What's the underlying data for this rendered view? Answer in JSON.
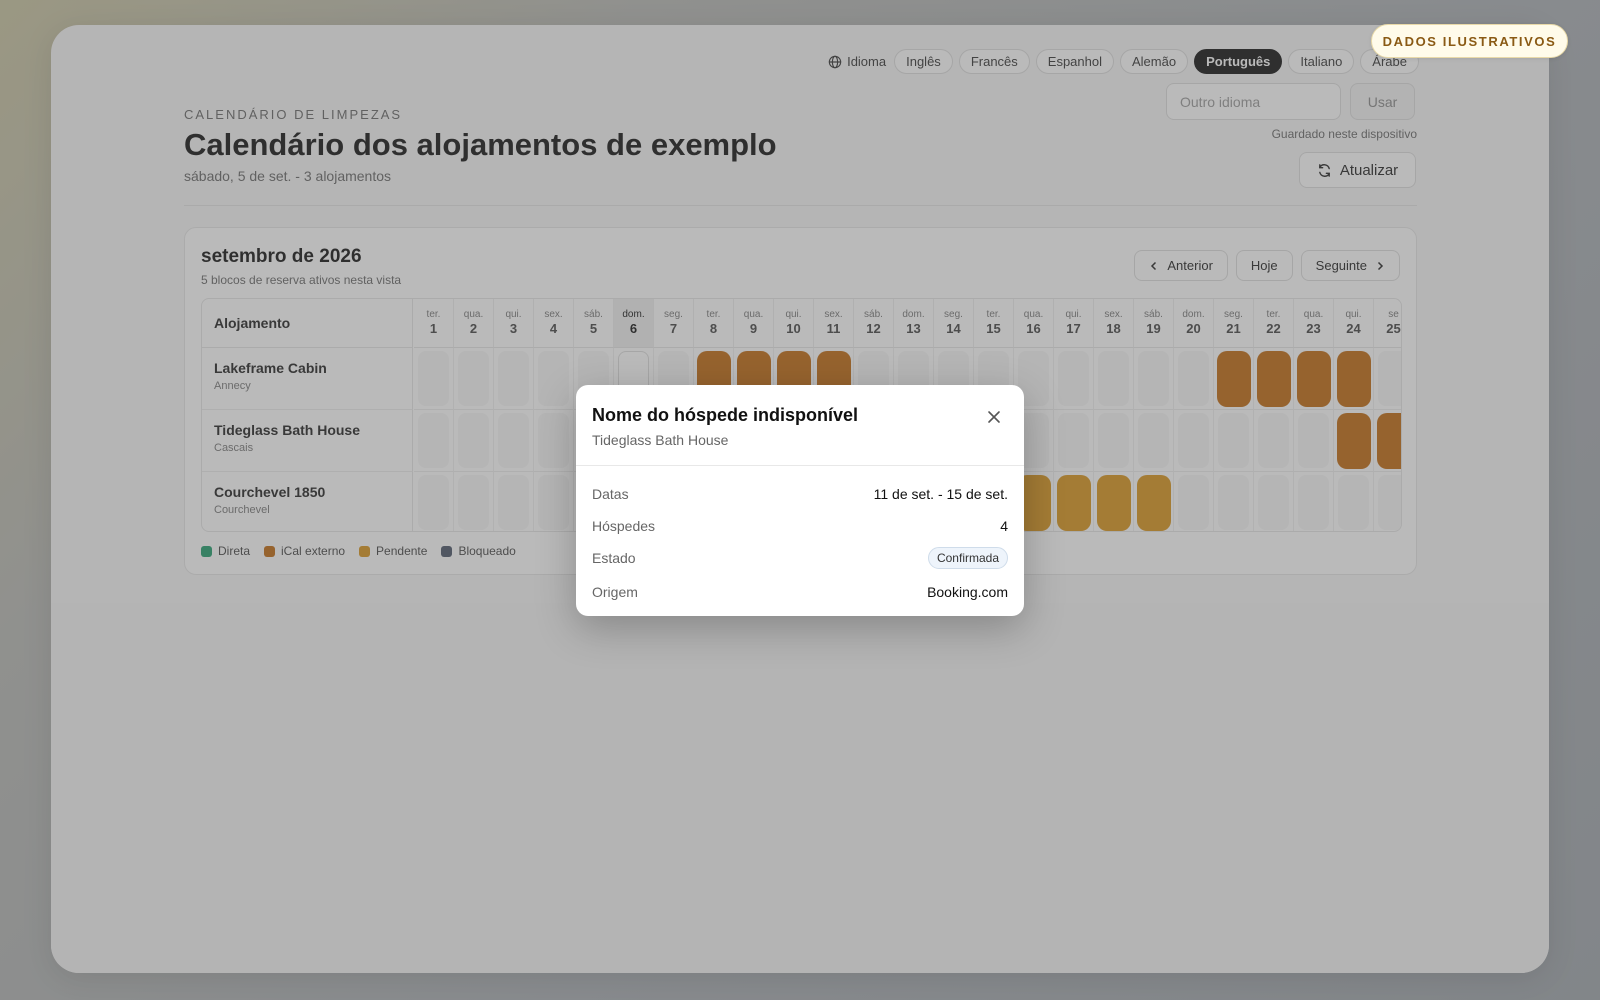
{
  "badge": "DADOS ILUSTRATIVOS",
  "language": {
    "label": "Idioma",
    "options": [
      {
        "label": "Inglês",
        "active": false
      },
      {
        "label": "Francês",
        "active": false
      },
      {
        "label": "Espanhol",
        "active": false
      },
      {
        "label": "Alemão",
        "active": false
      },
      {
        "label": "Português",
        "active": true
      },
      {
        "label": "Italiano",
        "active": false
      },
      {
        "label": "Árabe",
        "active": false
      }
    ],
    "other_placeholder": "Outro idioma",
    "use_label": "Usar",
    "saved_note": "Guardado neste dispositivo"
  },
  "header": {
    "eyebrow": "CALENDÁRIO DE LIMPEZAS",
    "title": "Calendário dos alojamentos de exemplo",
    "subtitle": "sábado, 5 de set. - 3 alojamentos",
    "refresh_label": "Atualizar"
  },
  "calendar": {
    "month": "setembro de 2026",
    "count_text": "5 blocos de reserva ativos nesta vista",
    "nav": {
      "prev": "Anterior",
      "today": "Hoje",
      "next": "Seguinte"
    },
    "property_header": "Alojamento",
    "today_index": 5,
    "days": [
      {
        "dw": "ter.",
        "dn": "1"
      },
      {
        "dw": "qua.",
        "dn": "2"
      },
      {
        "dw": "qui.",
        "dn": "3"
      },
      {
        "dw": "sex.",
        "dn": "4"
      },
      {
        "dw": "sáb.",
        "dn": "5"
      },
      {
        "dw": "dom.",
        "dn": "6"
      },
      {
        "dw": "seg.",
        "dn": "7"
      },
      {
        "dw": "ter.",
        "dn": "8"
      },
      {
        "dw": "qua.",
        "dn": "9"
      },
      {
        "dw": "qui.",
        "dn": "10"
      },
      {
        "dw": "sex.",
        "dn": "11"
      },
      {
        "dw": "sáb.",
        "dn": "12"
      },
      {
        "dw": "dom.",
        "dn": "13"
      },
      {
        "dw": "seg.",
        "dn": "14"
      },
      {
        "dw": "ter.",
        "dn": "15"
      },
      {
        "dw": "qua.",
        "dn": "16"
      },
      {
        "dw": "qui.",
        "dn": "17"
      },
      {
        "dw": "sex.",
        "dn": "18"
      },
      {
        "dw": "sáb.",
        "dn": "19"
      },
      {
        "dw": "dom.",
        "dn": "20"
      },
      {
        "dw": "seg.",
        "dn": "21"
      },
      {
        "dw": "ter.",
        "dn": "22"
      },
      {
        "dw": "qua.",
        "dn": "23"
      },
      {
        "dw": "qui.",
        "dn": "24"
      },
      {
        "dw": "se",
        "dn": "25"
      }
    ],
    "properties": [
      {
        "name": "Lakeframe Cabin",
        "city": "Annecy",
        "blocks": [
          {
            "days": [
              8,
              9,
              10,
              11
            ],
            "kind": "ical"
          },
          {
            "days": [
              21,
              22,
              23,
              24
            ],
            "kind": "ical"
          }
        ]
      },
      {
        "name": "Tideglass Bath House",
        "city": "Cascais",
        "blocks": [
          {
            "days": [
              24,
              25
            ],
            "kind": "ical"
          }
        ]
      },
      {
        "name": "Courchevel 1850",
        "city": "Courchevel",
        "blocks": [
          {
            "days": [
              16,
              17,
              18,
              19
            ],
            "kind": "pending"
          }
        ]
      }
    ],
    "legend": [
      {
        "label": "Direta",
        "color": "#1f9d6b"
      },
      {
        "label": "iCal externo",
        "color": "#c2690f"
      },
      {
        "label": "Pendente",
        "color": "#d9941a"
      },
      {
        "label": "Bloqueado",
        "color": "#4a5568"
      }
    ]
  },
  "modal": {
    "title": "Nome do hóspede indisponível",
    "subtitle": "Tideglass Bath House",
    "rows": [
      {
        "key": "Datas",
        "value": "11 de set. - 15 de set."
      },
      {
        "key": "Hóspedes",
        "value": "4"
      },
      {
        "key": "Estado",
        "value": "Confirmada"
      },
      {
        "key": "Origem",
        "value": "Booking.com"
      }
    ]
  }
}
